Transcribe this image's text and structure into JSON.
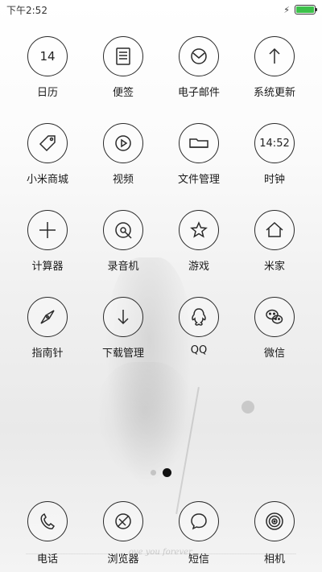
{
  "status_bar": {
    "time": "下午2:52",
    "charging_icon": "bolt-icon",
    "battery_color": "#3cc14a"
  },
  "apps": [
    {
      "id": "calendar",
      "label": "日历",
      "icon": "calendar-icon",
      "icon_text": "14"
    },
    {
      "id": "notes",
      "label": "便签",
      "icon": "notes-icon"
    },
    {
      "id": "email",
      "label": "电子邮件",
      "icon": "email-icon"
    },
    {
      "id": "updater",
      "label": "系统更新",
      "icon": "update-arrow-icon"
    },
    {
      "id": "mi-store",
      "label": "小米商城",
      "icon": "tag-icon"
    },
    {
      "id": "video",
      "label": "视频",
      "icon": "play-icon"
    },
    {
      "id": "file-manager",
      "label": "文件管理",
      "icon": "folder-icon"
    },
    {
      "id": "clock",
      "label": "时钟",
      "icon": "clock-icon",
      "icon_text": "14:52"
    },
    {
      "id": "calculator",
      "label": "计算器",
      "icon": "plus-icon"
    },
    {
      "id": "recorder",
      "label": "录音机",
      "icon": "recorder-icon"
    },
    {
      "id": "games",
      "label": "游戏",
      "icon": "star-icon"
    },
    {
      "id": "mi-home",
      "label": "米家",
      "icon": "home-icon"
    },
    {
      "id": "compass",
      "label": "指南针",
      "icon": "compass-icon"
    },
    {
      "id": "downloads",
      "label": "下载管理",
      "icon": "download-icon"
    },
    {
      "id": "qq",
      "label": "QQ",
      "icon": "qq-icon"
    },
    {
      "id": "wechat",
      "label": "微信",
      "icon": "wechat-icon"
    }
  ],
  "page_indicator": {
    "count": 2,
    "active": 2
  },
  "dock": [
    {
      "id": "phone",
      "label": "电话",
      "icon": "phone-icon"
    },
    {
      "id": "browser",
      "label": "浏览器",
      "icon": "browser-icon"
    },
    {
      "id": "messages",
      "label": "短信",
      "icon": "message-icon"
    },
    {
      "id": "camera",
      "label": "相机",
      "icon": "camera-icon"
    }
  ],
  "wallpaper": {
    "caption": "ove you forever"
  }
}
